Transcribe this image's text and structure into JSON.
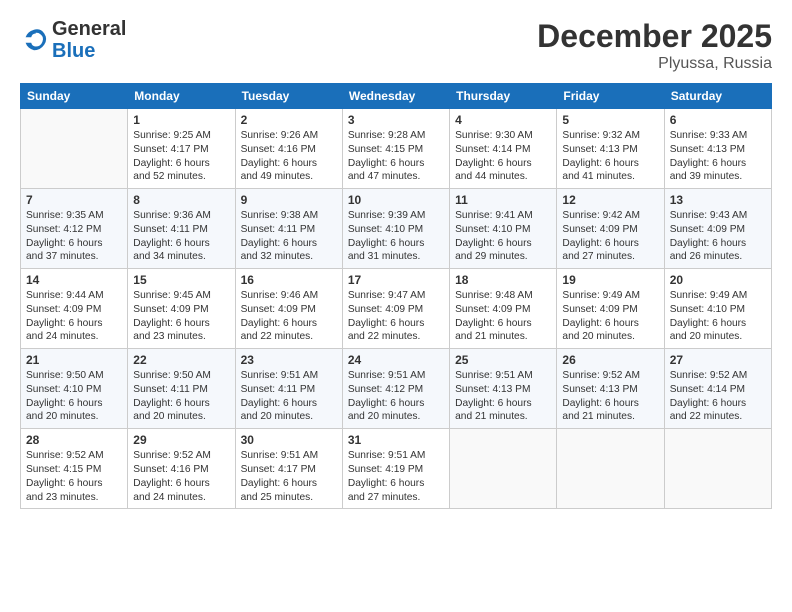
{
  "header": {
    "logo_general": "General",
    "logo_blue": "Blue",
    "title": "December 2025",
    "location": "Plyussa, Russia"
  },
  "columns": [
    "Sunday",
    "Monday",
    "Tuesday",
    "Wednesday",
    "Thursday",
    "Friday",
    "Saturday"
  ],
  "rows": [
    [
      {
        "day": "",
        "info": ""
      },
      {
        "day": "1",
        "info": "Sunrise: 9:25 AM\nSunset: 4:17 PM\nDaylight: 6 hours\nand 52 minutes."
      },
      {
        "day": "2",
        "info": "Sunrise: 9:26 AM\nSunset: 4:16 PM\nDaylight: 6 hours\nand 49 minutes."
      },
      {
        "day": "3",
        "info": "Sunrise: 9:28 AM\nSunset: 4:15 PM\nDaylight: 6 hours\nand 47 minutes."
      },
      {
        "day": "4",
        "info": "Sunrise: 9:30 AM\nSunset: 4:14 PM\nDaylight: 6 hours\nand 44 minutes."
      },
      {
        "day": "5",
        "info": "Sunrise: 9:32 AM\nSunset: 4:13 PM\nDaylight: 6 hours\nand 41 minutes."
      },
      {
        "day": "6",
        "info": "Sunrise: 9:33 AM\nSunset: 4:13 PM\nDaylight: 6 hours\nand 39 minutes."
      }
    ],
    [
      {
        "day": "7",
        "info": "Sunrise: 9:35 AM\nSunset: 4:12 PM\nDaylight: 6 hours\nand 37 minutes."
      },
      {
        "day": "8",
        "info": "Sunrise: 9:36 AM\nSunset: 4:11 PM\nDaylight: 6 hours\nand 34 minutes."
      },
      {
        "day": "9",
        "info": "Sunrise: 9:38 AM\nSunset: 4:11 PM\nDaylight: 6 hours\nand 32 minutes."
      },
      {
        "day": "10",
        "info": "Sunrise: 9:39 AM\nSunset: 4:10 PM\nDaylight: 6 hours\nand 31 minutes."
      },
      {
        "day": "11",
        "info": "Sunrise: 9:41 AM\nSunset: 4:10 PM\nDaylight: 6 hours\nand 29 minutes."
      },
      {
        "day": "12",
        "info": "Sunrise: 9:42 AM\nSunset: 4:09 PM\nDaylight: 6 hours\nand 27 minutes."
      },
      {
        "day": "13",
        "info": "Sunrise: 9:43 AM\nSunset: 4:09 PM\nDaylight: 6 hours\nand 26 minutes."
      }
    ],
    [
      {
        "day": "14",
        "info": "Sunrise: 9:44 AM\nSunset: 4:09 PM\nDaylight: 6 hours\nand 24 minutes."
      },
      {
        "day": "15",
        "info": "Sunrise: 9:45 AM\nSunset: 4:09 PM\nDaylight: 6 hours\nand 23 minutes."
      },
      {
        "day": "16",
        "info": "Sunrise: 9:46 AM\nSunset: 4:09 PM\nDaylight: 6 hours\nand 22 minutes."
      },
      {
        "day": "17",
        "info": "Sunrise: 9:47 AM\nSunset: 4:09 PM\nDaylight: 6 hours\nand 22 minutes."
      },
      {
        "day": "18",
        "info": "Sunrise: 9:48 AM\nSunset: 4:09 PM\nDaylight: 6 hours\nand 21 minutes."
      },
      {
        "day": "19",
        "info": "Sunrise: 9:49 AM\nSunset: 4:09 PM\nDaylight: 6 hours\nand 20 minutes."
      },
      {
        "day": "20",
        "info": "Sunrise: 9:49 AM\nSunset: 4:10 PM\nDaylight: 6 hours\nand 20 minutes."
      }
    ],
    [
      {
        "day": "21",
        "info": "Sunrise: 9:50 AM\nSunset: 4:10 PM\nDaylight: 6 hours\nand 20 minutes."
      },
      {
        "day": "22",
        "info": "Sunrise: 9:50 AM\nSunset: 4:11 PM\nDaylight: 6 hours\nand 20 minutes."
      },
      {
        "day": "23",
        "info": "Sunrise: 9:51 AM\nSunset: 4:11 PM\nDaylight: 6 hours\nand 20 minutes."
      },
      {
        "day": "24",
        "info": "Sunrise: 9:51 AM\nSunset: 4:12 PM\nDaylight: 6 hours\nand 20 minutes."
      },
      {
        "day": "25",
        "info": "Sunrise: 9:51 AM\nSunset: 4:13 PM\nDaylight: 6 hours\nand 21 minutes."
      },
      {
        "day": "26",
        "info": "Sunrise: 9:52 AM\nSunset: 4:13 PM\nDaylight: 6 hours\nand 21 minutes."
      },
      {
        "day": "27",
        "info": "Sunrise: 9:52 AM\nSunset: 4:14 PM\nDaylight: 6 hours\nand 22 minutes."
      }
    ],
    [
      {
        "day": "28",
        "info": "Sunrise: 9:52 AM\nSunset: 4:15 PM\nDaylight: 6 hours\nand 23 minutes."
      },
      {
        "day": "29",
        "info": "Sunrise: 9:52 AM\nSunset: 4:16 PM\nDaylight: 6 hours\nand 24 minutes."
      },
      {
        "day": "30",
        "info": "Sunrise: 9:51 AM\nSunset: 4:17 PM\nDaylight: 6 hours\nand 25 minutes."
      },
      {
        "day": "31",
        "info": "Sunrise: 9:51 AM\nSunset: 4:19 PM\nDaylight: 6 hours\nand 27 minutes."
      },
      {
        "day": "",
        "info": ""
      },
      {
        "day": "",
        "info": ""
      },
      {
        "day": "",
        "info": ""
      }
    ]
  ]
}
